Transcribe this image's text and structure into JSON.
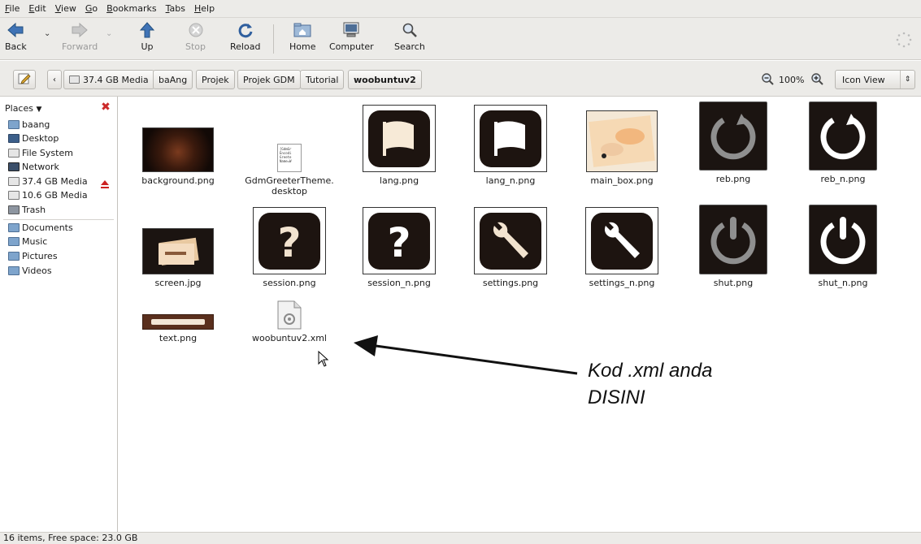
{
  "menubar": {
    "items": [
      "File",
      "Edit",
      "View",
      "Go",
      "Bookmarks",
      "Tabs",
      "Help"
    ]
  },
  "toolbar": {
    "back": "Back",
    "forward": "Forward",
    "up": "Up",
    "stop": "Stop",
    "reload": "Reload",
    "home": "Home",
    "computer": "Computer",
    "search": "Search"
  },
  "location": {
    "crumbs": [
      "37.4 GB Media",
      "baAng",
      "Projek",
      "Projek GDM",
      "Tutorial",
      "woobuntuv2"
    ],
    "zoom": "100%",
    "view_mode": "Icon View"
  },
  "sidebar": {
    "title": "Places",
    "places": [
      "baang",
      "Desktop",
      "File System",
      "Network",
      "37.4 GB Media",
      "10.6 GB Media",
      "Trash"
    ],
    "bookmarks": [
      "Documents",
      "Music",
      "Pictures",
      "Videos"
    ]
  },
  "files": [
    {
      "name": "background.png"
    },
    {
      "name": "GdmGreeterTheme.\ndesktop",
      "preview_text": "[GdmGr\nEncodi\nGreete\nName=W"
    },
    {
      "name": "lang.png"
    },
    {
      "name": "lang_n.png"
    },
    {
      "name": "main_box.png"
    },
    {
      "name": "reb.png"
    },
    {
      "name": "reb_n.png"
    },
    {
      "name": "screen.jpg"
    },
    {
      "name": "session.png"
    },
    {
      "name": "session_n.png"
    },
    {
      "name": "settings.png"
    },
    {
      "name": "settings_n.png"
    },
    {
      "name": "shut.png"
    },
    {
      "name": "shut_n.png"
    },
    {
      "name": "text.png"
    },
    {
      "name": "woobuntuv2.xml"
    }
  ],
  "statusbar": {
    "text": "16 items, Free space: 23.0 GB"
  },
  "annotation": {
    "line1": "Kod .xml anda",
    "line2": "DISINI"
  },
  "colors": {
    "chrome_bg": "#ecebe8",
    "tile_dark": "#1b1411",
    "close_red": "#cc2a2a",
    "eject_red": "#cc2222"
  }
}
